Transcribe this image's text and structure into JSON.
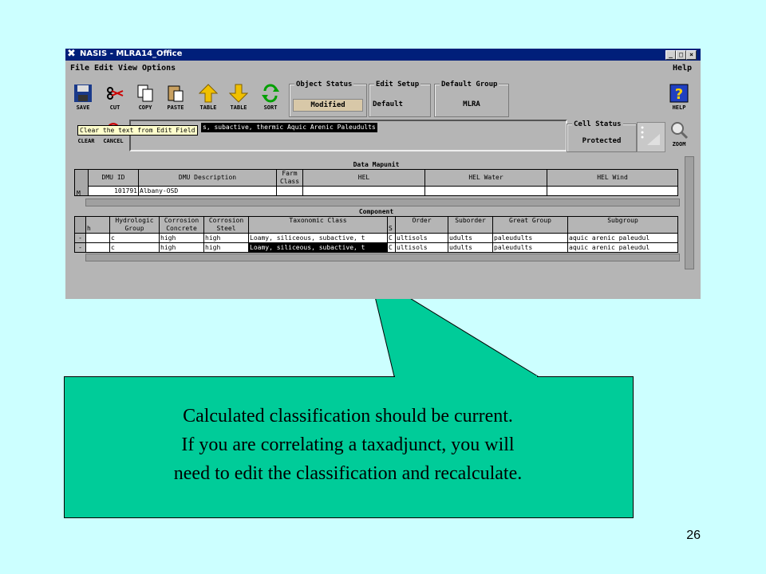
{
  "window": {
    "title": "NASIS - MLRA14_Office"
  },
  "window_controls": {
    "minimize": "_",
    "maximize": "□",
    "close": "×"
  },
  "menu": {
    "file": "File",
    "edit": "Edit",
    "view": "View",
    "options": "Options",
    "help": "Help"
  },
  "toolbar": {
    "save": "SAVE",
    "cut": "CUT",
    "copy": "COPY",
    "paste": "PASTE",
    "table_up": "TABLE",
    "table_down": "TABLE",
    "sort": "SORT",
    "help": "HELP",
    "clear": "CLEAR",
    "cancel": "CANCEL",
    "zoom": "ZOOM"
  },
  "status_groups": {
    "object_status": {
      "label": "Object Status",
      "value": "Modified"
    },
    "edit_setup": {
      "label": "Edit Setup",
      "value": "Default"
    },
    "default_group": {
      "label": "Default Group",
      "value": "MLRA"
    },
    "cell_status": {
      "label": "Cell Status",
      "value": "Protected"
    }
  },
  "edit_field": {
    "text": "Clear the text from Edit Field",
    "value": "s, subactive, thermic Aquic Arenic Paleudults"
  },
  "data_mapunit": {
    "title": "Data Mapunit",
    "headers": [
      "DMU ID",
      "DMU Description",
      "Farm Class",
      "HEL",
      "HEL Water",
      "HEL Wind"
    ],
    "row": {
      "marker": "M",
      "dmu_id": "101791",
      "description": "Albany-OSD"
    }
  },
  "component": {
    "title": "Component",
    "headers": [
      "h",
      "Hydrologic Group",
      "Corrosion Concrete",
      "Corrosion Steel",
      "Taxonomic Class",
      "S",
      "Order",
      "Suborder",
      "Great Group",
      "Subgroup"
    ],
    "rows": [
      {
        "marker": "-",
        "hydro": "c",
        "concrete": "high",
        "steel": "high",
        "taxclass": "Loamy, siliceous, subactive, t",
        "s": "C",
        "order": "ultisols",
        "suborder": "udults",
        "greatgroup": "paleudults",
        "subgroup": "aquic arenic paleudul"
      },
      {
        "marker": "-",
        "hydro": "c",
        "concrete": "high",
        "steel": "high",
        "taxclass": "Loamy, siliceous, subactive, t",
        "s": "C",
        "order": "ultisols",
        "suborder": "udults",
        "greatgroup": "paleudults",
        "subgroup": "aquic arenic paleudul"
      }
    ]
  },
  "callout": {
    "line1": "Calculated classification should be current.",
    "line2": "If you are correlating a taxadjunct, you will",
    "line3": "need to edit the classification and recalculate."
  },
  "slide_number": "26",
  "colors": {
    "background": "#ccffff",
    "callout": "#00cc99",
    "titlebar": "#001f7a",
    "window": "#b5b5b5"
  }
}
